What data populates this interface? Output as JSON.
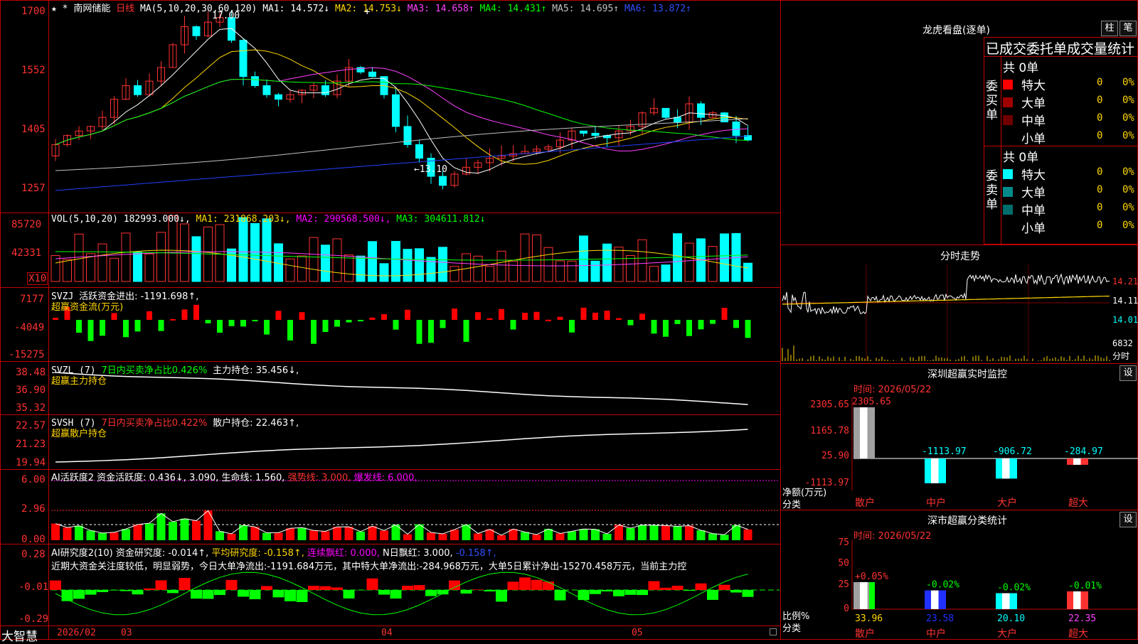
{
  "main": {
    "star": "★ *",
    "stock_name": "南网储能",
    "period": "日线",
    "ma_label": "MA(5,10,20,30,60,120)",
    "ma": [
      {
        "name": "MA1",
        "value": "14.572",
        "arrow": "↓",
        "color": "#ffffff"
      },
      {
        "name": "MA2",
        "value": "14.753",
        "arrow": "↓",
        "color": "#ffd700"
      },
      {
        "name": "MA3",
        "value": "14.658",
        "arrow": "↑",
        "color": "#ff40ff"
      },
      {
        "name": "MA4",
        "value": "14.431",
        "arrow": "↑",
        "color": "#00ff00"
      },
      {
        "name": "MA5",
        "value": "14.695",
        "arrow": "↑",
        "color": "#c0c0c0"
      },
      {
        "name": "MA6",
        "value": "13.872",
        "arrow": "↑",
        "color": "#3050ff"
      }
    ],
    "axis": [
      "1700",
      "1552",
      "1405",
      "1257"
    ],
    "high_mark": "17.00",
    "low_mark": "←13.10",
    "bottom_left": "大智慧",
    "dates": [
      "2026/02",
      "03",
      "04",
      "05"
    ],
    "cursor_mark": "+"
  },
  "vol": {
    "label": "VOL(5,10,20)",
    "value": "182993.000↓,",
    "ma1": "MA1: 231868.203↓,",
    "ma2": "MA2: 290568.500↓,",
    "ma3": "MA3: 304611.812↓",
    "axis": [
      "85720",
      "42331"
    ],
    "unit": "X10"
  },
  "svzj": {
    "label": "SVZJ",
    "text": "活跃资金进出: -1191.698↑,",
    "sub": "超赢资金流(万元)",
    "axis": [
      "7177",
      "-4049",
      "-15275"
    ]
  },
  "svzl": {
    "label": "SVZL (7)",
    "text1": "7日内买卖净占比0.426%",
    "text2": "主力持仓: 35.456↓,",
    "sub": "超赢主力持仓",
    "axis": [
      "38.48",
      "36.90",
      "35.32"
    ]
  },
  "svsh": {
    "label": "SVSH (7)",
    "text1": "7日内买卖净占比0.422%",
    "text2": "散户持仓: 22.463↑,",
    "sub": "超赢散户持仓",
    "axis": [
      "22.57",
      "21.23",
      "19.94"
    ]
  },
  "ai1": {
    "label": "AI活跃度2",
    "t1": "资金活跃度: 0.436↓,",
    "t2": "3.090,",
    "t3": "生命线: 1.560,",
    "t4": "强势线: 3.000,",
    "t5": "爆发线: 6.000,",
    "axis": [
      "6.00",
      "2.96",
      "0.00"
    ]
  },
  "ai2": {
    "label": "AI研究度2(10)",
    "t1": "资金研究度: -0.014↑,",
    "t2": "平均研究度: -0.158↑,",
    "t3": "连续飘红: 0.000,",
    "t4": "N日飘红: 3.000,",
    "t5": "-0.158↑,",
    "comment": "近期大资金关注度较低，明显弱势，今日大单净流出:-1191.684万元，其中特大单净流出:-284.968万元，大单5日累计净出-15270.458万元，当前主力控",
    "axis": [
      "0.28",
      "-0.01",
      "-0.29"
    ]
  },
  "right": {
    "lhb_title": "龙虎看盘(逐单)",
    "btn_zhu": "柱",
    "btn_bi": "笔",
    "stat_title": "已成交委托单成交量统计",
    "buy_side": "委买单",
    "sell_side": "委卖单",
    "buy_total": "共 0单",
    "sell_total": "共 0单",
    "buy_rows": [
      {
        "label": "特大",
        "color": "#ff0000",
        "val": "0",
        "pct": "0%"
      },
      {
        "label": "大单",
        "color": "#a00000",
        "val": "0",
        "pct": "0%"
      },
      {
        "label": "中单",
        "color": "#700000",
        "val": "0",
        "pct": "0%"
      },
      {
        "label": "小单",
        "color": "",
        "val": "0",
        "pct": "0%"
      }
    ],
    "sell_rows": [
      {
        "label": "特大",
        "color": "#00ffff",
        "val": "0",
        "pct": "0%"
      },
      {
        "label": "大单",
        "color": "#008b8b",
        "val": "0",
        "pct": "0%"
      },
      {
        "label": "中单",
        "color": "#006d6d",
        "val": "0",
        "pct": "0%"
      },
      {
        "label": "小单",
        "color": "",
        "val": "0",
        "pct": "0%"
      }
    ],
    "fenshi_title": "分时走势",
    "fenshi_axis": [
      "14.21",
      "14.11",
      "14.01"
    ],
    "fenshi_vol": "6832",
    "fenshi_unit": "分时",
    "monitor_title": "深圳超赢实时监控",
    "monitor_time": "时间: 2026/05/22",
    "monitor_btn": "设",
    "monitor_axis": [
      "2305.65",
      "1165.78",
      "25.90",
      "-1113.97"
    ],
    "monitor_y_label": "净额(万元)",
    "monitor_x_label": "分类",
    "stat2_title": "深市超赢分类统计",
    "stat2_time": "时间: 2026/05/22",
    "stat2_btn": "设",
    "stat2_axis": [
      "75",
      "50",
      "25",
      "0"
    ],
    "stat2_y_label": "比例%",
    "stat2_x_label": "分类"
  },
  "chart_data": [
    {
      "type": "bar",
      "title": "深圳超赢实时监控",
      "categories": [
        "散户",
        "中户",
        "大户",
        "超大"
      ],
      "values": [
        2305.65,
        -1113.97,
        -906.72,
        -284.97
      ],
      "labels": [
        "2305.65",
        "-1113.97",
        "-906.72",
        "-284.97"
      ],
      "ylabel": "净额(万元)",
      "ylim": [
        -1113.97,
        2305.65
      ]
    },
    {
      "type": "bar",
      "title": "深市超赢分类统计",
      "categories": [
        "散户",
        "中户",
        "大户",
        "超大"
      ],
      "values": [
        33.96,
        23.58,
        20.1,
        22.35
      ],
      "labels": [
        "33.96",
        "23.58",
        "20.10",
        "22.35"
      ],
      "changes": [
        "+0.05%",
        "-0.02%",
        "-0.02%",
        "-0.01%"
      ],
      "ylabel": "比例%",
      "ylim": [
        0,
        75
      ]
    }
  ]
}
